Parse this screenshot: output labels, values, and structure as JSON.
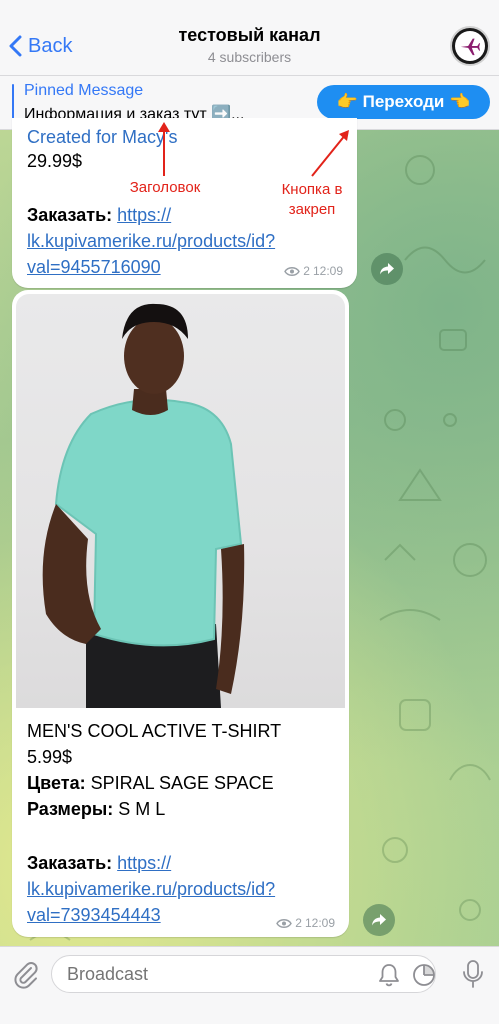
{
  "header": {
    "back_label": "Back",
    "title": "тестовый канал",
    "subtitle": "4 subscribers",
    "avatar_icon": "airplane-icon"
  },
  "pinned": {
    "label": "Pinned Message",
    "text": "Информация и заказ тут ➡️...",
    "button_label": "👉 Переходи 👈"
  },
  "messages": [
    {
      "brand_line": "Created for Macy's",
      "price": "29.99$",
      "order_label": "Заказать",
      "link_line1": "https://",
      "link_line2": "lk.kupivamerike.ru/products/id?",
      "link_line3": "val=9455716090",
      "views": "2",
      "time": "12:09"
    },
    {
      "title": "MEN'S COOL ACTIVE T-SHIRT",
      "price": "5.99$",
      "colors_label": "Цвета",
      "colors_value": "SPIRAL SAGE SPACE",
      "sizes_label": "Размеры",
      "sizes_value": "S M L",
      "order_label": "Заказать",
      "link_line1": "https://",
      "link_line2": "lk.kupivamerike.ru/products/id?",
      "link_line3": "val=7393454443",
      "views": "2",
      "time": "12:09"
    }
  ],
  "annotations": {
    "heading_label": "Заголовок",
    "button_label_line1": "Кнопка в",
    "button_label_line2": "закреп"
  },
  "input": {
    "placeholder": "Broadcast"
  },
  "colors": {
    "accent": "#3478f6",
    "pin_button": "#1e8ef2",
    "annotation": "#e2231a",
    "link": "#2f6fc4"
  }
}
